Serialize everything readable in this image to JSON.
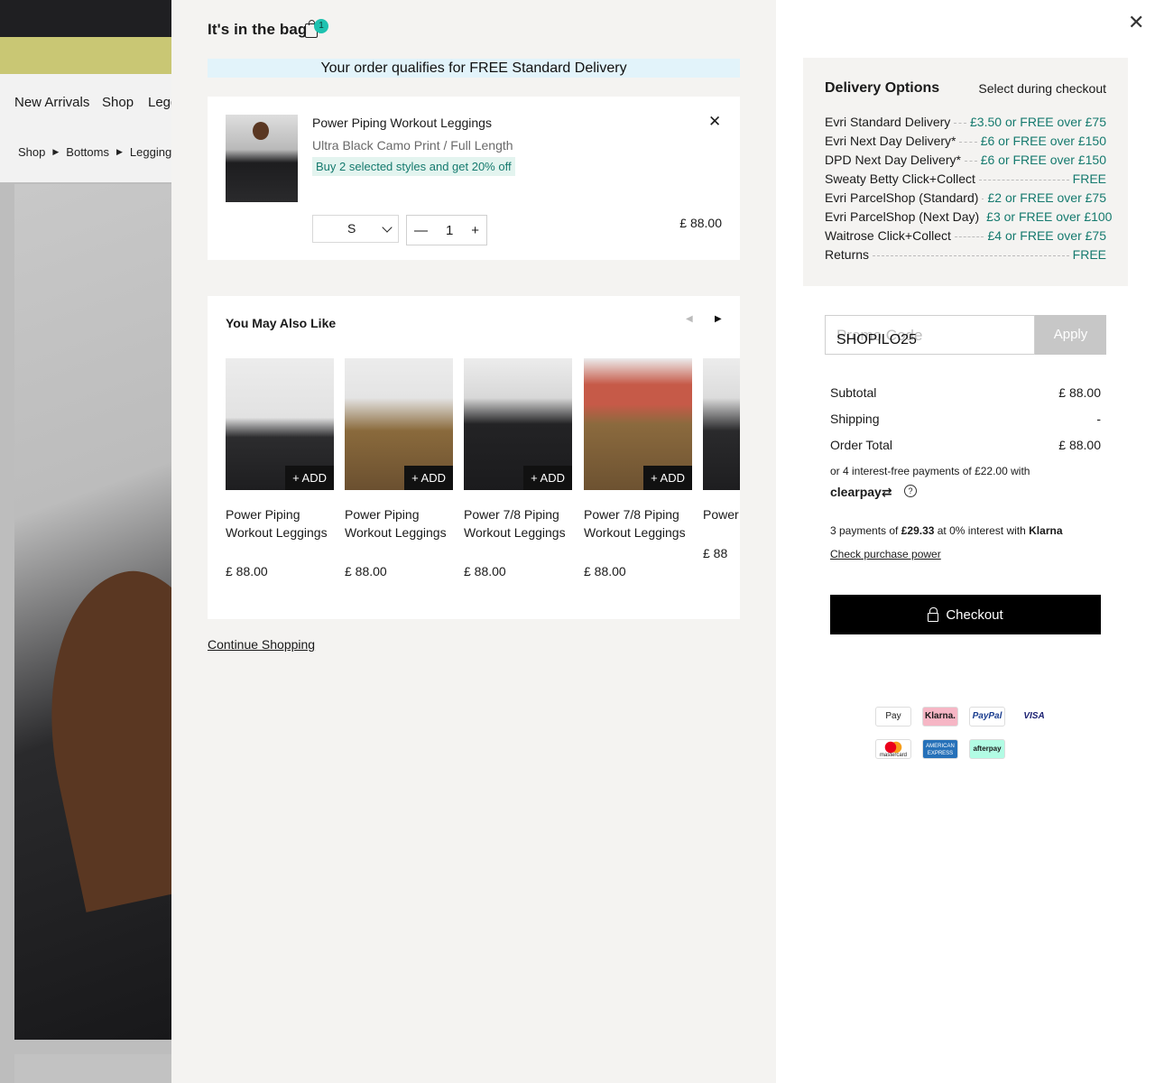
{
  "background": {
    "nav": [
      "New Arrivals",
      "Shop",
      "Legg"
    ],
    "breadcrumb": [
      "Shop",
      "Bottoms",
      "Leggings"
    ]
  },
  "bag": {
    "title": "It's in the bag",
    "count": "1",
    "free_banner": "Your order qualifies for FREE Standard Delivery",
    "item": {
      "name": "Power Piping Workout Leggings",
      "variant": "Ultra Black Camo Print / Full Length",
      "promo": "Buy 2 selected styles and get 20% off",
      "remove": "✕",
      "size": "S",
      "qty": "1",
      "minus": "—",
      "plus": "+",
      "price": "£ 88.00"
    },
    "also_like": {
      "title": "You May Also Like",
      "add_label": "+ ADD",
      "products": [
        {
          "name": "Power Piping Workout Leggings",
          "price": "£ 88.00"
        },
        {
          "name": "Power Piping Workout Leggings",
          "price": "£ 88.00"
        },
        {
          "name": "Power 7/8 Piping Workout Leggings",
          "price": "£ 88.00"
        },
        {
          "name": "Power 7/8 Piping Workout Leggings",
          "price": "£ 88.00"
        },
        {
          "name": "Power Workout",
          "price": "£ 88"
        }
      ]
    },
    "continue": "Continue Shopping"
  },
  "delivery": {
    "title": "Delivery Options",
    "subtitle": "Select during checkout",
    "rows": [
      {
        "name": "Evri Standard Delivery",
        "value": "£3.50 or FREE over £75"
      },
      {
        "name": "Evri Next Day Delivery*",
        "value": "£6 or FREE over £150"
      },
      {
        "name": "DPD Next Day Delivery*",
        "value": "£6 or FREE over £150"
      },
      {
        "name": "Sweaty Betty Click+Collect",
        "value": "FREE"
      },
      {
        "name": "Evri ParcelShop (Standard)",
        "value": "£2 or FREE over £75"
      },
      {
        "name": "Evri ParcelShop (Next Day)",
        "value": "£3 or FREE over £100"
      },
      {
        "name": "Waitrose Click+Collect",
        "value": "£4 or FREE over £75"
      },
      {
        "name": "Returns",
        "value": "FREE"
      }
    ]
  },
  "promo": {
    "placeholder": "Promo Code",
    "value": "SHOPILO25",
    "apply": "Apply"
  },
  "totals": {
    "subtotal_label": "Subtotal",
    "subtotal": "£ 88.00",
    "shipping_label": "Shipping",
    "shipping": "-",
    "total_label": "Order Total",
    "total": "£ 88.00"
  },
  "clearpay": {
    "text": "or 4 interest-free payments of £22.00 with",
    "logo": "clearpay⇄",
    "info": "?"
  },
  "klarna": {
    "prefix": "3 payments of ",
    "amount": "£29.33",
    "middle": " at 0% interest with ",
    "brand": "Klarna",
    "link": "Check purchase power"
  },
  "checkout": "Checkout",
  "payments": [
    "Pay",
    "Klarna.",
    "PayPal",
    "VISA",
    "mastercard",
    "AMERICAN EXPRESS",
    "afterpay"
  ],
  "colors": {
    "accent_teal": "#157a6e",
    "badge": "#1ec2b0",
    "banner": "#e2f3fa"
  }
}
